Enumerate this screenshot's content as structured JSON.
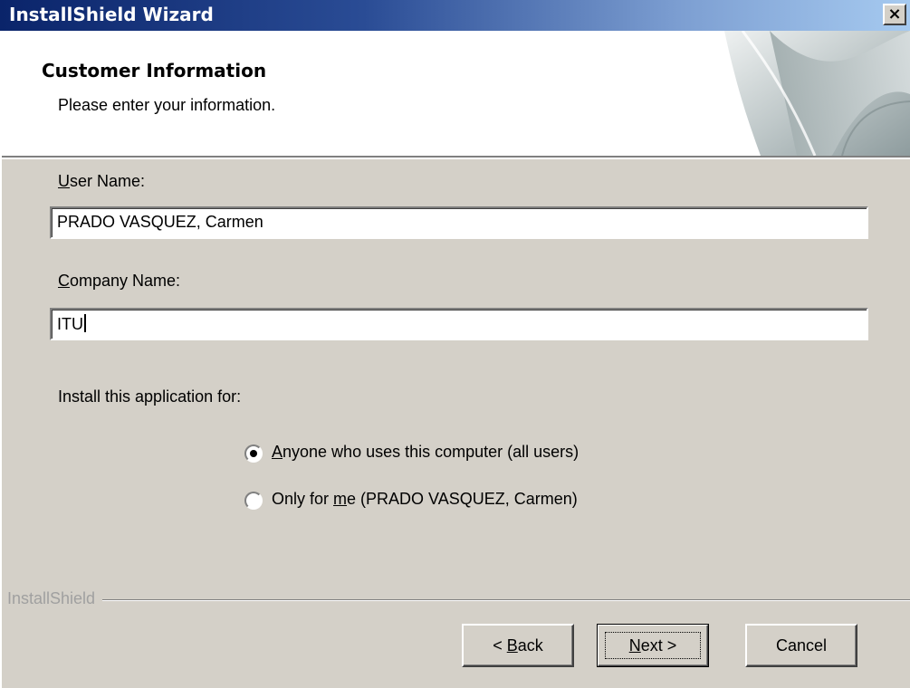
{
  "window": {
    "title": "InstallShield Wizard",
    "close_glyph": "×"
  },
  "header": {
    "heading": "Customer Information",
    "subheading": "Please enter your information."
  },
  "form": {
    "user_name_label_key": "U",
    "user_name_label_rest": "ser Name:",
    "user_name_value": "PRADO VASQUEZ, Carmen",
    "company_name_label_key": "C",
    "company_name_label_rest": "ompany Name:",
    "company_name_value": "ITU",
    "install_for_label": "Install this application for:",
    "options": [
      {
        "key": "A",
        "rest": "nyone who uses this computer (all users)",
        "selected": true
      },
      {
        "pre": "Only for ",
        "key": "m",
        "rest": "e (PRADO VASQUEZ, Carmen)",
        "selected": false
      }
    ]
  },
  "footer": {
    "brand": "InstallShield",
    "back_pre": "< ",
    "back_key": "B",
    "back_rest": "ack",
    "next_key": "N",
    "next_rest": "ext >",
    "cancel": "Cancel"
  },
  "colors": {
    "dialog_bg": "#d4d0c8",
    "title_gradient_start": "#0a246a",
    "title_gradient_end": "#a6caf0"
  },
  "icons": [
    "close-icon",
    "radio-selected-icon",
    "radio-unselected-icon",
    "page-curl-graphic"
  ]
}
